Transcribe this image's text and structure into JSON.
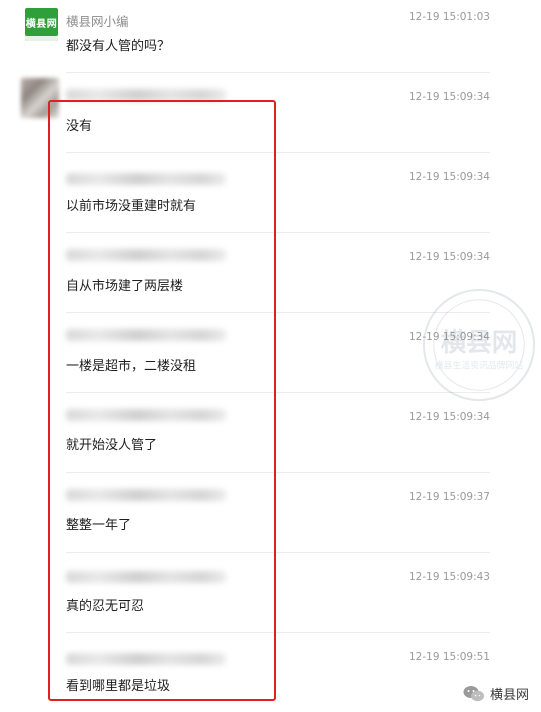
{
  "thread": {
    "first": {
      "avatar_text": "横县网",
      "name": "横县网小编",
      "time": "12-19 15:01:03",
      "text": "都没有人管的吗？"
    },
    "replies": [
      {
        "time": "12-19 15:09:34",
        "text": "没有"
      },
      {
        "time": "12-19 15:09:34",
        "text": "以前市场没重建时就有"
      },
      {
        "time": "12-19 15:09:34",
        "text": "自从市场建了两层楼"
      },
      {
        "time": "12-19 15:09:34",
        "text": "一楼是超市，二楼没租"
      },
      {
        "time": "12-19 15:09:34",
        "text": "就开始没人管了"
      },
      {
        "time": "12-19 15:09:37",
        "text": "整整一年了"
      },
      {
        "time": "12-19 15:09:43",
        "text": "真的忍无可忍"
      },
      {
        "time": "12-19 15:09:51",
        "text": "看到哪里都是垃圾"
      }
    ]
  },
  "watermark": {
    "main": "横县网",
    "sub": "横县生活资讯品牌网站"
  },
  "footer": {
    "label": "横县网",
    "icon": "wechat-icon"
  },
  "colors": {
    "highlight": "#e0201c",
    "brand_green": "#2f9f3a",
    "time_gray": "#9a9a9a"
  }
}
